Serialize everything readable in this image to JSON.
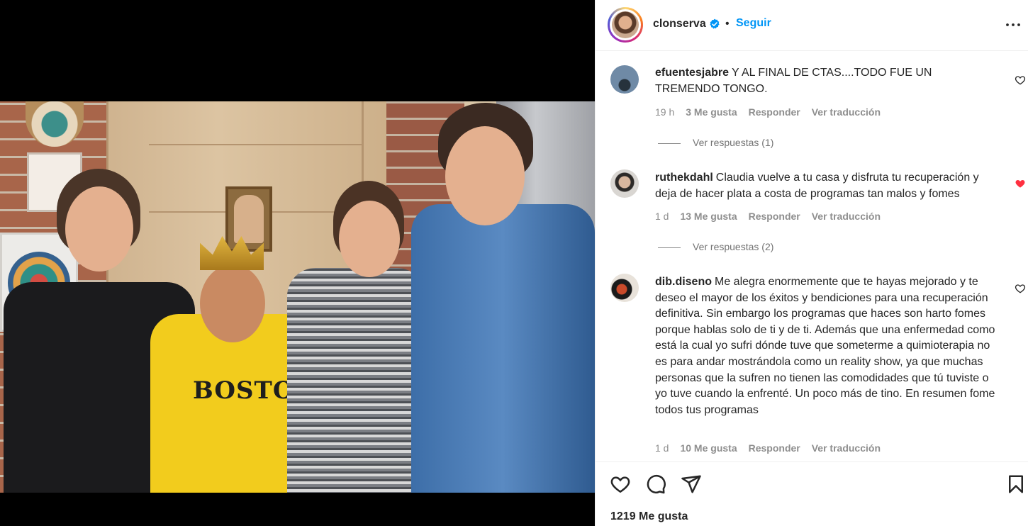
{
  "post": {
    "owner_username": "clonserva",
    "separator": "•",
    "follow_label": "Seguir",
    "likes_text": "1219 Me gusta"
  },
  "photo": {
    "shirt_text": "BOSTON"
  },
  "comments": [
    {
      "username": "efuentesjabre",
      "text": "Y AL FINAL DE CTAS....TODO FUE UN TREMENDO TONGO.",
      "time": "19 h",
      "likes": "3 Me gusta",
      "reply_label": "Responder",
      "translate_label": "Ver traducción",
      "replies_label": "Ver respuestas (1)",
      "liked": false
    },
    {
      "username": "ruthekdahl",
      "text": "Claudia vuelve a tu casa y disfruta tu recuperación y deja de hacer plata a costa de programas tan malos y fomes",
      "time": "1 d",
      "likes": "13 Me gusta",
      "reply_label": "Responder",
      "translate_label": "Ver traducción",
      "replies_label": "Ver respuestas (2)",
      "liked": true
    },
    {
      "username": "dib.diseno",
      "text": "Me alegra enormemente que te hayas mejorado y te deseo el mayor de los éxitos y bendiciones para una recuperación definitiva. Sin embargo los programas que haces son harto fomes porque hablas solo de ti y de ti. Además que una enfermedad como está la cual yo sufri dónde tuve que someterme a quimioterapia no es para andar mostrándola como un reality show, ya que muchas personas que la sufren no tienen las comodidades que tú tuviste o yo tuve cuando la enfrenté. Un poco más de tino. En resumen fome todos tus programas",
      "time": "1 d",
      "likes": "10 Me gusta",
      "reply_label": "Responder",
      "translate_label": "Ver traducción",
      "liked": false
    }
  ],
  "colors": {
    "accent_blue": "#0095f6",
    "like_red": "#ff3040",
    "text_primary": "#262626",
    "text_secondary": "#8e8e8e"
  },
  "icons": {
    "header": [
      "verified-badge-icon",
      "more-options-icon"
    ],
    "comment": [
      "heart-outline-icon",
      "heart-filled-icon"
    ],
    "actions": [
      "like-heart-icon",
      "comment-bubble-icon",
      "share-paper-plane-icon",
      "save-bookmark-icon"
    ]
  }
}
